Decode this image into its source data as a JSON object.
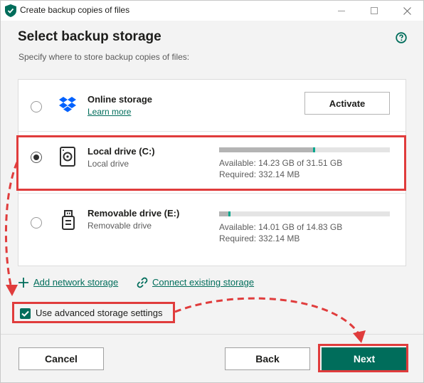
{
  "window": {
    "title": "Create backup copies of files",
    "controls": [
      "minimize",
      "maximize",
      "close"
    ]
  },
  "header": {
    "title": "Select backup storage",
    "subtitle": "Specify where to store backup copies of files:",
    "help_icon": "question-circle-icon"
  },
  "storage": {
    "options": [
      {
        "name": "Online storage",
        "link": "Learn more",
        "icon": "dropbox-icon",
        "selected": false,
        "action_label": "Activate"
      },
      {
        "name": "Local drive (C:)",
        "description": "Local drive",
        "icon": "hard-drive-icon",
        "selected": true,
        "available": "Available: 14.23 GB of 31.51 GB",
        "required": "Required: 332.14 MB",
        "used_fraction": 0.55
      },
      {
        "name": "Removable drive (E:)",
        "description": "Removable drive",
        "icon": "usb-drive-icon",
        "selected": false,
        "available": "Available: 14.01 GB of 14.83 GB",
        "required": "Required: 332.14 MB",
        "used_fraction": 0.055
      }
    ]
  },
  "links": {
    "add_network": "Add network storage",
    "connect_existing": "Connect existing storage"
  },
  "advanced": {
    "label": "Use advanced storage settings",
    "checked": true
  },
  "footer": {
    "cancel": "Cancel",
    "back": "Back",
    "next": "Next"
  },
  "colors": {
    "accent": "#006d5b",
    "progress_marker": "#00a88e",
    "highlight": "#e03c3c"
  }
}
